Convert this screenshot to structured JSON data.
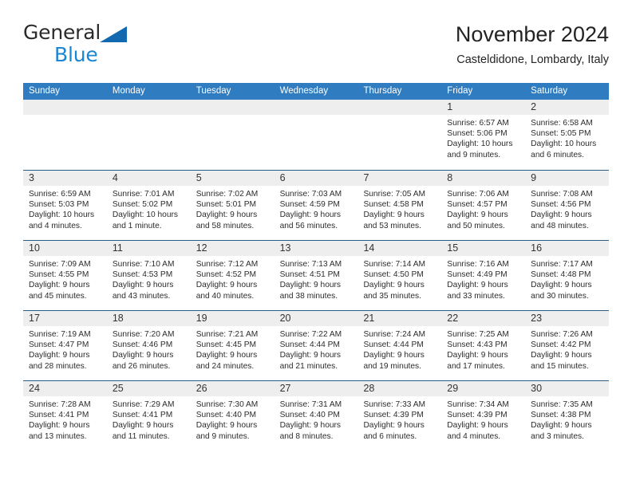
{
  "brand": {
    "word1": "General",
    "word2": "Blue",
    "triangle_color": "#1269b0",
    "blue_color": "#1b86d4"
  },
  "header": {
    "title": "November 2024",
    "subtitle": "Casteldidone, Lombardy, Italy"
  },
  "colors": {
    "header_row_bg": "#2f7cc0",
    "header_row_text": "#ffffff",
    "week_divider": "#2b5e86",
    "daynum_bg": "#eeeeee",
    "cell_bg": "#ffffff"
  },
  "calendar": {
    "day_headers": [
      "Sunday",
      "Monday",
      "Tuesday",
      "Wednesday",
      "Thursday",
      "Friday",
      "Saturday"
    ],
    "weeks": [
      [
        {
          "day": "",
          "lines": []
        },
        {
          "day": "",
          "lines": []
        },
        {
          "day": "",
          "lines": []
        },
        {
          "day": "",
          "lines": []
        },
        {
          "day": "",
          "lines": []
        },
        {
          "day": "1",
          "lines": [
            "Sunrise: 6:57 AM",
            "Sunset: 5:06 PM",
            "Daylight: 10 hours",
            "and 9 minutes."
          ]
        },
        {
          "day": "2",
          "lines": [
            "Sunrise: 6:58 AM",
            "Sunset: 5:05 PM",
            "Daylight: 10 hours",
            "and 6 minutes."
          ]
        }
      ],
      [
        {
          "day": "3",
          "lines": [
            "Sunrise: 6:59 AM",
            "Sunset: 5:03 PM",
            "Daylight: 10 hours",
            "and 4 minutes."
          ]
        },
        {
          "day": "4",
          "lines": [
            "Sunrise: 7:01 AM",
            "Sunset: 5:02 PM",
            "Daylight: 10 hours",
            "and 1 minute."
          ]
        },
        {
          "day": "5",
          "lines": [
            "Sunrise: 7:02 AM",
            "Sunset: 5:01 PM",
            "Daylight: 9 hours",
            "and 58 minutes."
          ]
        },
        {
          "day": "6",
          "lines": [
            "Sunrise: 7:03 AM",
            "Sunset: 4:59 PM",
            "Daylight: 9 hours",
            "and 56 minutes."
          ]
        },
        {
          "day": "7",
          "lines": [
            "Sunrise: 7:05 AM",
            "Sunset: 4:58 PM",
            "Daylight: 9 hours",
            "and 53 minutes."
          ]
        },
        {
          "day": "8",
          "lines": [
            "Sunrise: 7:06 AM",
            "Sunset: 4:57 PM",
            "Daylight: 9 hours",
            "and 50 minutes."
          ]
        },
        {
          "day": "9",
          "lines": [
            "Sunrise: 7:08 AM",
            "Sunset: 4:56 PM",
            "Daylight: 9 hours",
            "and 48 minutes."
          ]
        }
      ],
      [
        {
          "day": "10",
          "lines": [
            "Sunrise: 7:09 AM",
            "Sunset: 4:55 PM",
            "Daylight: 9 hours",
            "and 45 minutes."
          ]
        },
        {
          "day": "11",
          "lines": [
            "Sunrise: 7:10 AM",
            "Sunset: 4:53 PM",
            "Daylight: 9 hours",
            "and 43 minutes."
          ]
        },
        {
          "day": "12",
          "lines": [
            "Sunrise: 7:12 AM",
            "Sunset: 4:52 PM",
            "Daylight: 9 hours",
            "and 40 minutes."
          ]
        },
        {
          "day": "13",
          "lines": [
            "Sunrise: 7:13 AM",
            "Sunset: 4:51 PM",
            "Daylight: 9 hours",
            "and 38 minutes."
          ]
        },
        {
          "day": "14",
          "lines": [
            "Sunrise: 7:14 AM",
            "Sunset: 4:50 PM",
            "Daylight: 9 hours",
            "and 35 minutes."
          ]
        },
        {
          "day": "15",
          "lines": [
            "Sunrise: 7:16 AM",
            "Sunset: 4:49 PM",
            "Daylight: 9 hours",
            "and 33 minutes."
          ]
        },
        {
          "day": "16",
          "lines": [
            "Sunrise: 7:17 AM",
            "Sunset: 4:48 PM",
            "Daylight: 9 hours",
            "and 30 minutes."
          ]
        }
      ],
      [
        {
          "day": "17",
          "lines": [
            "Sunrise: 7:19 AM",
            "Sunset: 4:47 PM",
            "Daylight: 9 hours",
            "and 28 minutes."
          ]
        },
        {
          "day": "18",
          "lines": [
            "Sunrise: 7:20 AM",
            "Sunset: 4:46 PM",
            "Daylight: 9 hours",
            "and 26 minutes."
          ]
        },
        {
          "day": "19",
          "lines": [
            "Sunrise: 7:21 AM",
            "Sunset: 4:45 PM",
            "Daylight: 9 hours",
            "and 24 minutes."
          ]
        },
        {
          "day": "20",
          "lines": [
            "Sunrise: 7:22 AM",
            "Sunset: 4:44 PM",
            "Daylight: 9 hours",
            "and 21 minutes."
          ]
        },
        {
          "day": "21",
          "lines": [
            "Sunrise: 7:24 AM",
            "Sunset: 4:44 PM",
            "Daylight: 9 hours",
            "and 19 minutes."
          ]
        },
        {
          "day": "22",
          "lines": [
            "Sunrise: 7:25 AM",
            "Sunset: 4:43 PM",
            "Daylight: 9 hours",
            "and 17 minutes."
          ]
        },
        {
          "day": "23",
          "lines": [
            "Sunrise: 7:26 AM",
            "Sunset: 4:42 PM",
            "Daylight: 9 hours",
            "and 15 minutes."
          ]
        }
      ],
      [
        {
          "day": "24",
          "lines": [
            "Sunrise: 7:28 AM",
            "Sunset: 4:41 PM",
            "Daylight: 9 hours",
            "and 13 minutes."
          ]
        },
        {
          "day": "25",
          "lines": [
            "Sunrise: 7:29 AM",
            "Sunset: 4:41 PM",
            "Daylight: 9 hours",
            "and 11 minutes."
          ]
        },
        {
          "day": "26",
          "lines": [
            "Sunrise: 7:30 AM",
            "Sunset: 4:40 PM",
            "Daylight: 9 hours",
            "and 9 minutes."
          ]
        },
        {
          "day": "27",
          "lines": [
            "Sunrise: 7:31 AM",
            "Sunset: 4:40 PM",
            "Daylight: 9 hours",
            "and 8 minutes."
          ]
        },
        {
          "day": "28",
          "lines": [
            "Sunrise: 7:33 AM",
            "Sunset: 4:39 PM",
            "Daylight: 9 hours",
            "and 6 minutes."
          ]
        },
        {
          "day": "29",
          "lines": [
            "Sunrise: 7:34 AM",
            "Sunset: 4:39 PM",
            "Daylight: 9 hours",
            "and 4 minutes."
          ]
        },
        {
          "day": "30",
          "lines": [
            "Sunrise: 7:35 AM",
            "Sunset: 4:38 PM",
            "Daylight: 9 hours",
            "and 3 minutes."
          ]
        }
      ]
    ]
  }
}
